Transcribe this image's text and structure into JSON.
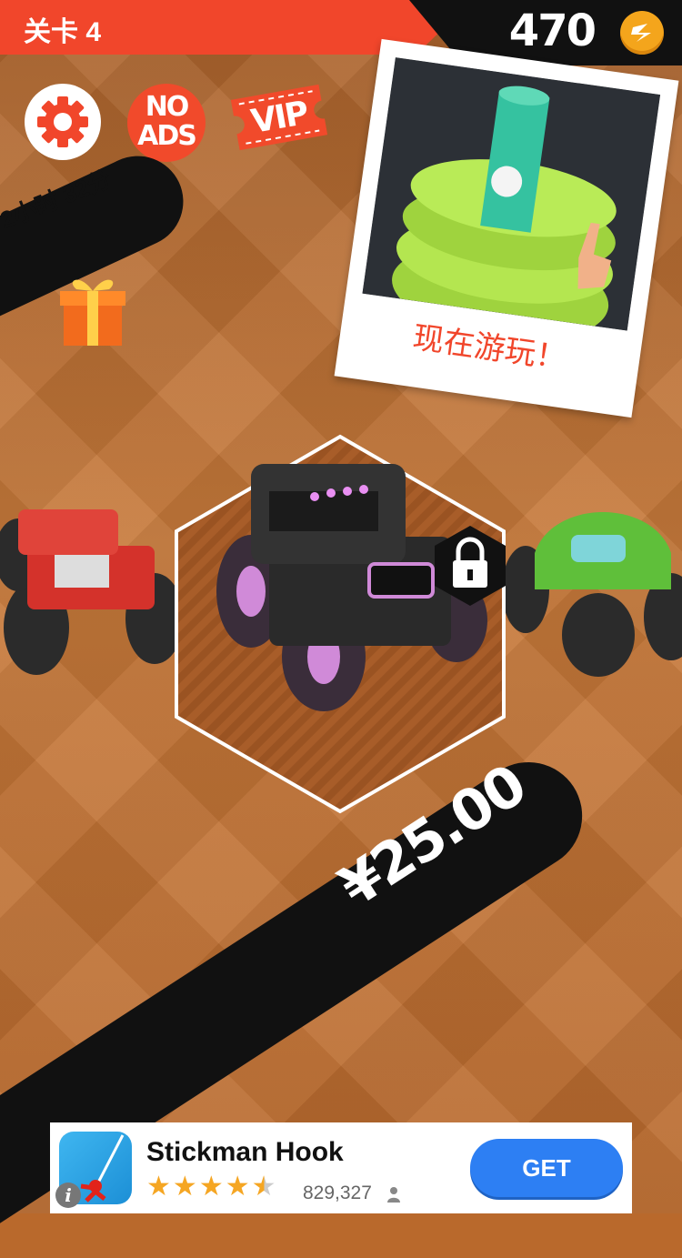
{
  "top_bar": {
    "level_label": "关卡 4",
    "coins": "470",
    "accent_color": "#f1462b",
    "coin_icon": "coin-icon"
  },
  "buttons": {
    "settings_icon": "gear-icon",
    "no_ads_line1": "NO",
    "no_ads_line2": "ADS",
    "vip_label": "VIP"
  },
  "gift": {
    "timer": "2小时 32分",
    "icon": "gift-icon"
  },
  "promo": {
    "cta": "现在游玩！"
  },
  "vehicle_select": {
    "selected_locked": true,
    "lock_icon": "lock-icon",
    "vehicles": [
      {
        "name": "red-monster-truck",
        "color": "#d4322b"
      },
      {
        "name": "black-monster-suv",
        "color": "#2b2b2b"
      },
      {
        "name": "green-monster-beetle",
        "color": "#5fbf3a"
      }
    ]
  },
  "price": {
    "label": "¥25.00"
  },
  "ad": {
    "title": "Stickman Hook",
    "rating_count": "829,327",
    "stars": 4.5,
    "get_label": "GET",
    "info_label": "i"
  }
}
